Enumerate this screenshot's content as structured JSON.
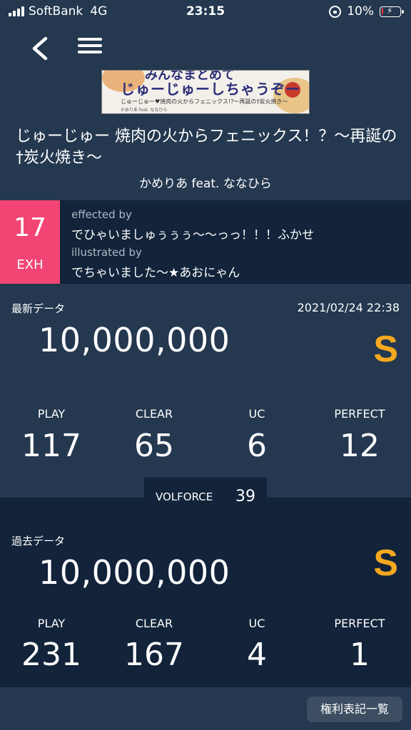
{
  "status_bar": {
    "carrier": "SoftBank",
    "network": "4G",
    "time": "23:15",
    "battery_percent": "10%",
    "battery_level": 0.1,
    "battery_color": "#ff3b30"
  },
  "nav": {
    "back_icon": "chevron-left-icon",
    "menu_icon": "hamburger-menu-icon"
  },
  "banner": {
    "top_text": "みんなまとめて",
    "main_text": "じゅーじゅーしちゃうぞー",
    "sub_text": "じゅーじゅー♥焼肉の火からフェニックス!?～再誕の†炭火焼き～",
    "sub_text2": "かめりあ feat. ななひら"
  },
  "song": {
    "title": "じゅーじゅー 焼肉の火からフェニックス！？～再誕の†炭火焼き～",
    "artist": "かめりあ feat. ななひら"
  },
  "chart": {
    "level": "17",
    "difficulty": "EXH",
    "difficulty_color": "#f24574",
    "effected_label": "effected by",
    "effected_by": "でひゃいましゅぅぅぅ〜〜っっ！！！ふかせ",
    "illustrated_label": "illustrated by",
    "illustrated_by": "でちゃいました〜★あおにゃん"
  },
  "latest": {
    "label": "最新データ",
    "date": "2021/02/24 22:38",
    "score": "10,000,000",
    "grade": "S",
    "stats": [
      {
        "label": "PLAY",
        "value": "117"
      },
      {
        "label": "CLEAR",
        "value": "65"
      },
      {
        "label": "UC",
        "value": "6"
      },
      {
        "label": "PERFECT",
        "value": "12"
      }
    ]
  },
  "volforce": {
    "label": "VOLFORCE",
    "value": "39"
  },
  "past": {
    "label": "過去データ",
    "score": "10,000,000",
    "grade": "S",
    "stats": [
      {
        "label": "PLAY",
        "value": "231"
      },
      {
        "label": "CLEAR",
        "value": "167"
      },
      {
        "label": "UC",
        "value": "4"
      },
      {
        "label": "PERFECT",
        "value": "1"
      }
    ]
  },
  "footer": {
    "rights_button": "権利表記一覧"
  },
  "colors": {
    "background": "#24384f",
    "panel": "#12233a",
    "grade": "#f6a81f"
  }
}
